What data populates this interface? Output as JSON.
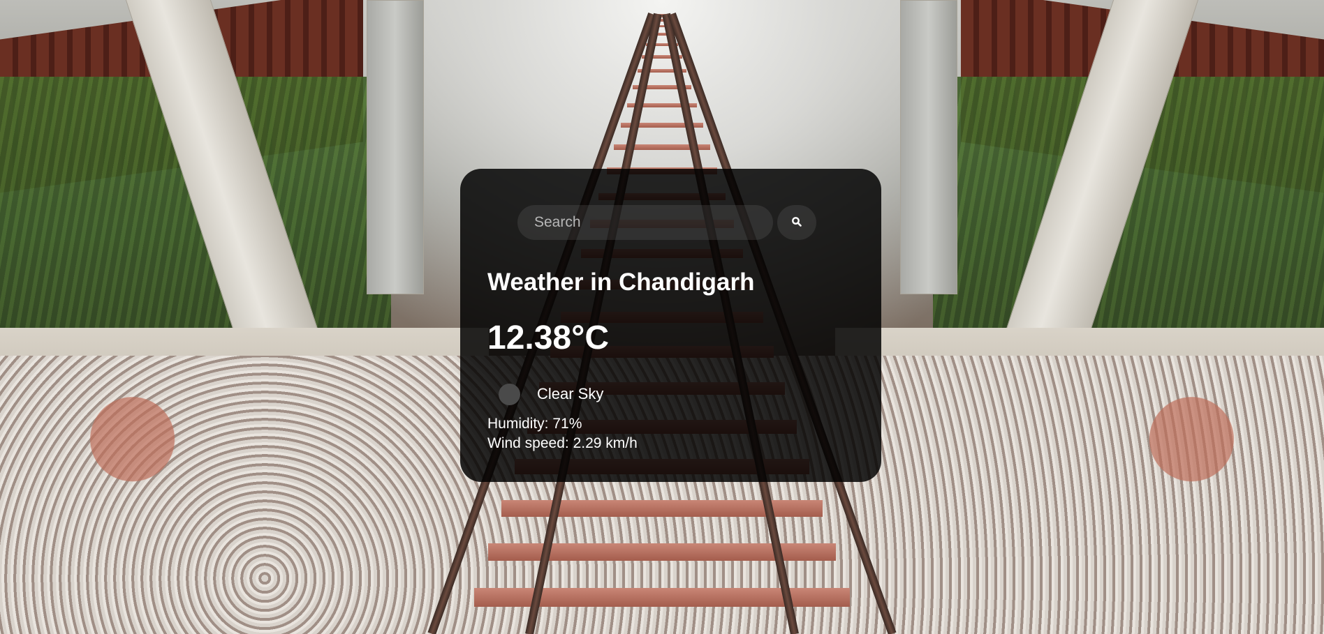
{
  "search": {
    "placeholder": "Search",
    "button_icon": "search-icon"
  },
  "weather": {
    "title": "Weather in Chandigarh",
    "temperature": "12.38°C",
    "condition": "Clear Sky",
    "condition_icon": "weather-icon",
    "humidity": "Humidity: 71%",
    "wind": "Wind speed: 2.29 km/h"
  },
  "colors": {
    "card_background": "#000000",
    "text": "#ffffff"
  }
}
